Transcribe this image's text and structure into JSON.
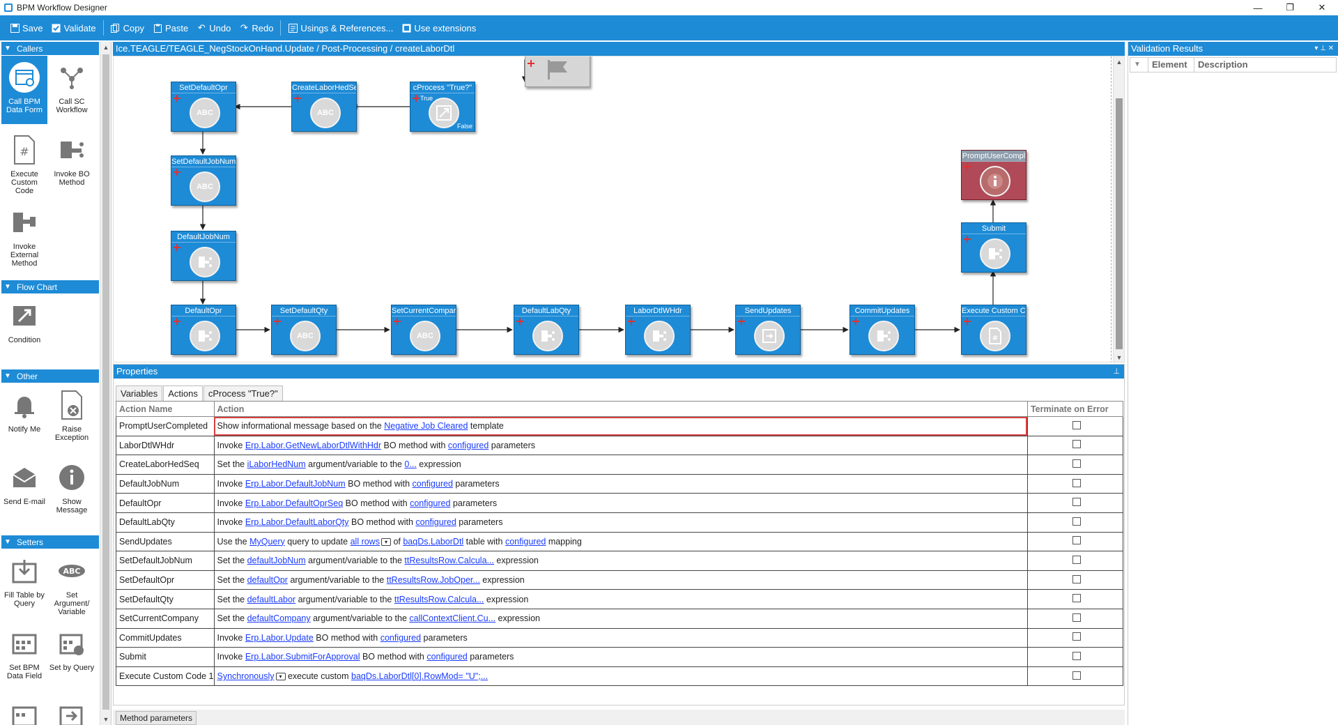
{
  "window": {
    "title": "BPM Workflow Designer",
    "controls": [
      "—",
      "❐",
      "✕"
    ]
  },
  "toolbar": {
    "save": "Save",
    "validate": "Validate",
    "copy": "Copy",
    "paste": "Paste",
    "undo": "Undo",
    "redo": "Redo",
    "usings": "Usings & References...",
    "extensions": "Use extensions"
  },
  "palette": {
    "callers_header": "Callers",
    "callers": [
      {
        "label": "Call BPM Data Form"
      },
      {
        "label": "Call SC Workflow"
      },
      {
        "label": "Execute Custom Code"
      },
      {
        "label": "Invoke BO Method"
      },
      {
        "label": "Invoke External Method"
      }
    ],
    "flowchart_header": "Flow Chart",
    "flowchart": [
      {
        "label": "Condition"
      }
    ],
    "other_header": "Other",
    "other": [
      {
        "label": "Notify Me"
      },
      {
        "label": "Raise Exception"
      },
      {
        "label": "Send E-mail"
      },
      {
        "label": "Show Message"
      }
    ],
    "setters_header": "Setters",
    "setters": [
      {
        "label": "Fill Table by Query"
      },
      {
        "label": "Set Argument/ Variable"
      },
      {
        "label": "Set BPM Data Field"
      },
      {
        "label": "Set by Query"
      }
    ]
  },
  "breadcrumb": "Ice.TEAGLE/TEAGLE_NegStockOnHand.Update / Post-Processing / createLaborDtl",
  "nodes": {
    "setDefaultOpr": "SetDefaultOpr",
    "createLaborHedSeq": "CreateLaborHedSe",
    "cProcess": "cProcess \"True?\"",
    "setDefaultJobNum": "SetDefaultJobNum",
    "defaultJobNum": "DefaultJobNum",
    "defaultOpr": "DefaultOpr",
    "setDefaultQty": "SetDefaultQty",
    "setCurrentCompany": "SetCurrentCompar",
    "defaultLabQty": "DefaultLabQty",
    "laborDtlWHdr": "LaborDtlWHdr",
    "sendUpdates": "SendUpdates",
    "commitUpdates": "CommitUpdates",
    "executeCustom": "Execute Custom Co",
    "submit": "Submit",
    "promptUser": "PromptUserCompl",
    "true_tag": "True",
    "false_tag": "False",
    "abc": "ABC"
  },
  "validation": {
    "title": "Validation Results",
    "col_element": "Element",
    "col_description": "Description"
  },
  "properties": {
    "title": "Properties",
    "tabs": [
      "Variables",
      "Actions",
      "cProcess \"True?\""
    ],
    "columns": {
      "name": "Action Name",
      "action": "Action",
      "terminate": "Terminate on Error"
    },
    "rows": [
      {
        "name": "PromptUserCompleted",
        "parts": [
          [
            "t",
            "Show informational message based on the "
          ],
          [
            "l",
            "Negative Job Cleared"
          ],
          [
            "t",
            " template"
          ]
        ]
      },
      {
        "name": "LaborDtlWHdr",
        "parts": [
          [
            "t",
            "Invoke "
          ],
          [
            "l",
            "Erp.Labor.GetNewLaborDtlWithHdr"
          ],
          [
            "t",
            " BO method with "
          ],
          [
            "l",
            "configured"
          ],
          [
            "t",
            " parameters"
          ]
        ]
      },
      {
        "name": "CreateLaborHedSeq",
        "parts": [
          [
            "t",
            "Set the "
          ],
          [
            "l",
            "iLaborHedNum"
          ],
          [
            "t",
            " argument/variable to the "
          ],
          [
            "l",
            "0..."
          ],
          [
            "t",
            " expression"
          ]
        ]
      },
      {
        "name": "DefaultJobNum",
        "parts": [
          [
            "t",
            "Invoke "
          ],
          [
            "l",
            "Erp.Labor.DefaultJobNum"
          ],
          [
            "t",
            " BO method with "
          ],
          [
            "l",
            "configured"
          ],
          [
            "t",
            " parameters"
          ]
        ]
      },
      {
        "name": "DefaultOpr",
        "parts": [
          [
            "t",
            "Invoke "
          ],
          [
            "l",
            "Erp.Labor.DefaultOprSeq"
          ],
          [
            "t",
            " BO method with "
          ],
          [
            "l",
            "configured"
          ],
          [
            "t",
            " parameters"
          ]
        ]
      },
      {
        "name": "DefaultLabQty",
        "parts": [
          [
            "t",
            "Invoke "
          ],
          [
            "l",
            "Erp.Labor.DefaultLaborQty"
          ],
          [
            "t",
            " BO method with "
          ],
          [
            "l",
            "configured"
          ],
          [
            "t",
            " parameters"
          ]
        ]
      },
      {
        "name": "SendUpdates",
        "parts": [
          [
            "t",
            "Use the "
          ],
          [
            "l",
            "MyQuery"
          ],
          [
            "t",
            " query to update "
          ],
          [
            "l",
            "all rows"
          ],
          [
            "d",
            ""
          ],
          [
            "t",
            " of "
          ],
          [
            "l",
            "baqDs.LaborDtl"
          ],
          [
            "t",
            " table with "
          ],
          [
            "l",
            "configured"
          ],
          [
            "t",
            " mapping"
          ]
        ]
      },
      {
        "name": "SetDefaultJobNum",
        "parts": [
          [
            "t",
            "Set the "
          ],
          [
            "l",
            "defaultJobNum"
          ],
          [
            "t",
            " argument/variable to the "
          ],
          [
            "l",
            "ttResultsRow.Calcula..."
          ],
          [
            "t",
            " expression"
          ]
        ]
      },
      {
        "name": "SetDefaultOpr",
        "parts": [
          [
            "t",
            "Set the "
          ],
          [
            "l",
            "defaultOpr"
          ],
          [
            "t",
            " argument/variable to the "
          ],
          [
            "l",
            "ttResultsRow.JobOper..."
          ],
          [
            "t",
            " expression"
          ]
        ]
      },
      {
        "name": "SetDefaultQty",
        "parts": [
          [
            "t",
            "Set the "
          ],
          [
            "l",
            "defaultLabor"
          ],
          [
            "t",
            " argument/variable to the "
          ],
          [
            "l",
            "ttResultsRow.Calcula..."
          ],
          [
            "t",
            " expression"
          ]
        ]
      },
      {
        "name": "SetCurrentCompany",
        "parts": [
          [
            "t",
            "Set the "
          ],
          [
            "l",
            "defaultCompany"
          ],
          [
            "t",
            " argument/variable to the "
          ],
          [
            "l",
            "callContextClient.Cu..."
          ],
          [
            "t",
            " expression"
          ]
        ]
      },
      {
        "name": "CommitUpdates",
        "parts": [
          [
            "t",
            "Invoke "
          ],
          [
            "l",
            "Erp.Labor.Update"
          ],
          [
            "t",
            " BO method with "
          ],
          [
            "l",
            "configured"
          ],
          [
            "t",
            " parameters"
          ]
        ]
      },
      {
        "name": "Submit",
        "parts": [
          [
            "t",
            "Invoke "
          ],
          [
            "l",
            "Erp.Labor.SubmitForApproval"
          ],
          [
            "t",
            " BO method with "
          ],
          [
            "l",
            "configured"
          ],
          [
            "t",
            " parameters"
          ]
        ]
      },
      {
        "name": "Execute Custom Code 1",
        "parts": [
          [
            "l",
            "Synchronously"
          ],
          [
            "d",
            ""
          ],
          [
            "t",
            " execute custom "
          ],
          [
            "l",
            "baqDs.LaborDtl[0].RowMod= \"U\";..."
          ]
        ]
      }
    ]
  },
  "status": {
    "method_params": "Method parameters"
  },
  "colors": {
    "accent": "#1e8bd6",
    "link": "#1a3cff",
    "selected_border": "#d84040"
  }
}
